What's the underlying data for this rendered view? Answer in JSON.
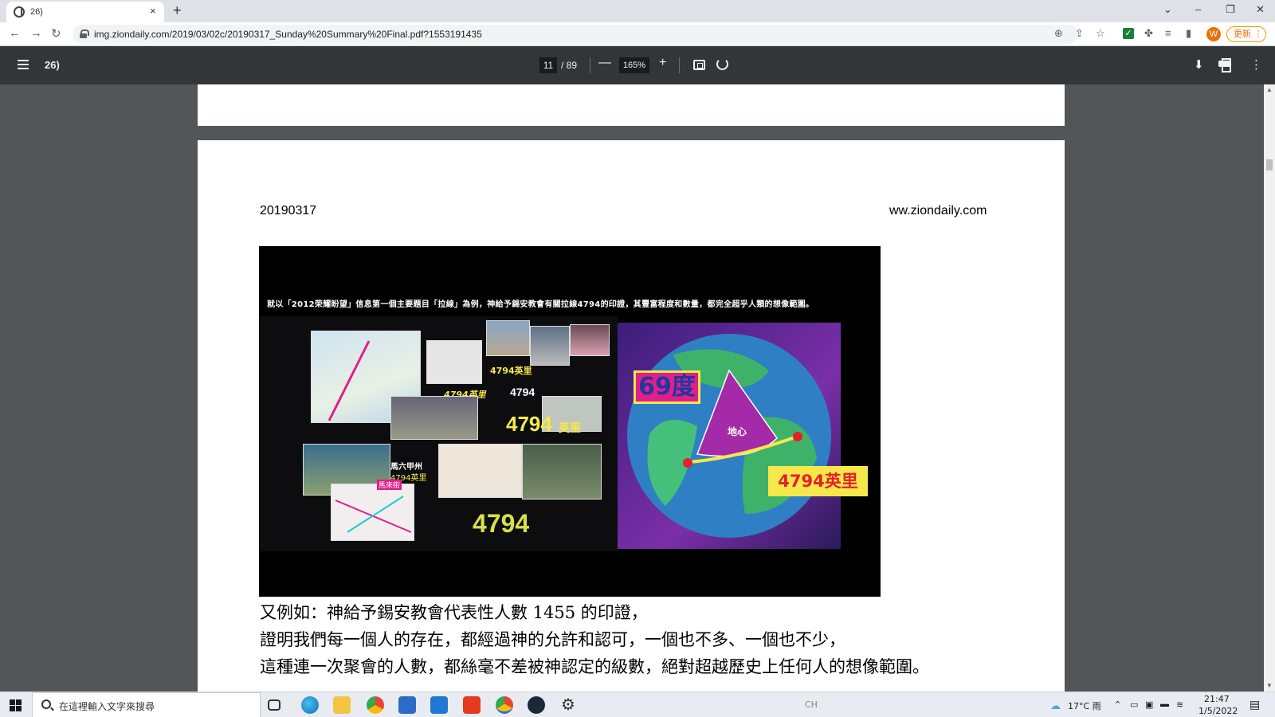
{
  "browser": {
    "tab_title": "26)",
    "tab_close": "×",
    "new_tab": "+",
    "minimize": "–",
    "restore": "❐",
    "close": "✕",
    "tab_search": "⌄",
    "url": "img.ziondaily.com/2019/03/02c/20190317_Sunday%20Summary%20Final.pdf?1553191435",
    "avatar_letter": "W",
    "update_label": "更新 ⋮"
  },
  "pdf_toolbar": {
    "title": "26)",
    "current_page": "11",
    "total_pages": "/ 89",
    "zoom": "165%",
    "zoom_out": "—",
    "zoom_in": "+"
  },
  "document": {
    "header_date": "20190317",
    "header_site": "ww.ziondaily.com",
    "figure": {
      "caption": "就以「2012荣耀盼望」信息第一個主要題目「拉線」為例，神給予錫安教會有關拉線4794的印證，其豐富程度和數量，都完全超乎人類的想像範圍。",
      "label_4794_miles": "4794英里",
      "label_4794": "4794",
      "label_4794_big": "4794",
      "label_4794_ying": "英里",
      "label_4794_bottom": "4794",
      "label_malacca": "馬六甲州",
      "label_malacca_sub": "4794英里",
      "label_malacca_st": "馬來街",
      "label_69deg": "69度",
      "label_earth_center": "地心",
      "label_earth_miles": "4794英里"
    },
    "body_lines": [
      "又例如：神給予錫安教會代表性人數 1455 的印證，",
      "證明我們每一個人的存在，都經過神的允許和認可，一個也不多、一個也不少，",
      "這種連一次聚會的人數，都絲毫不差被神認定的級數，絕對超越歷史上任何人的想像範圍。"
    ]
  },
  "taskbar": {
    "search_placeholder": "在這裡輸入文字來搜尋",
    "ime": "CH",
    "weather": "17°C 雨",
    "time": "21:47",
    "date": "1/5/2022"
  },
  "colors": {
    "pdf_bar": "#323639",
    "viewer_bg": "#525659",
    "accent_yellow": "#f6e84a",
    "magenta": "#e0208a"
  }
}
